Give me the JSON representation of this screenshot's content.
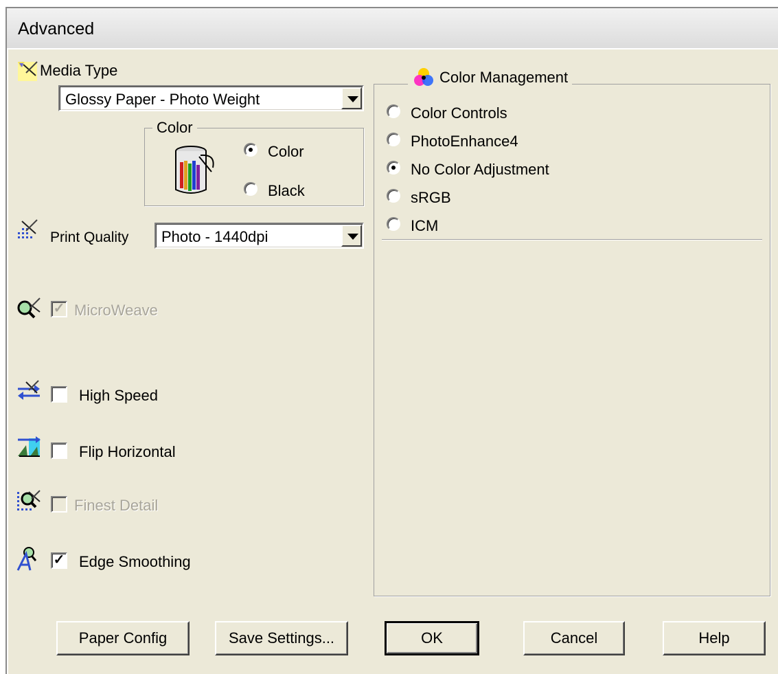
{
  "window": {
    "title": "Advanced"
  },
  "media_type": {
    "label": "Media Type",
    "value": "Glossy Paper - Photo Weight"
  },
  "color_group": {
    "title": "Color",
    "options": [
      {
        "label": "Color",
        "selected": true
      },
      {
        "label": "Black",
        "selected": false
      }
    ]
  },
  "print_quality": {
    "label": "Print Quality",
    "value": "Photo - 1440dpi"
  },
  "options": {
    "microweave": {
      "label": "MicroWeave",
      "checked": true,
      "enabled": false
    },
    "high_speed": {
      "label": "High Speed",
      "checked": false,
      "enabled": true
    },
    "flip_horizontal": {
      "label": "Flip Horizontal",
      "checked": false,
      "enabled": true
    },
    "finest_detail": {
      "label": "Finest Detail",
      "checked": false,
      "enabled": false
    },
    "edge_smoothing": {
      "label": "Edge Smoothing",
      "checked": true,
      "enabled": true
    }
  },
  "color_management": {
    "title": "Color Management",
    "options": [
      {
        "label": "Color Controls",
        "selected": false
      },
      {
        "label": "PhotoEnhance4",
        "selected": false
      },
      {
        "label": "No Color Adjustment",
        "selected": true
      },
      {
        "label": "sRGB",
        "selected": false
      },
      {
        "label": "ICM",
        "selected": false
      }
    ]
  },
  "buttons": {
    "paper_config": "Paper Config",
    "save_settings": "Save Settings...",
    "ok": "OK",
    "cancel": "Cancel",
    "help": "Help"
  },
  "icons": {
    "media_type": "media-type-icon",
    "ink_can": "ink-can-icon",
    "print_quality": "print-quality-icon",
    "microweave": "microweave-icon",
    "high_speed": "high-speed-icon",
    "flip_horizontal": "flip-horizontal-icon",
    "finest_detail": "finest-detail-icon",
    "edge_smoothing": "edge-smoothing-icon",
    "color_management": "color-management-icon"
  }
}
